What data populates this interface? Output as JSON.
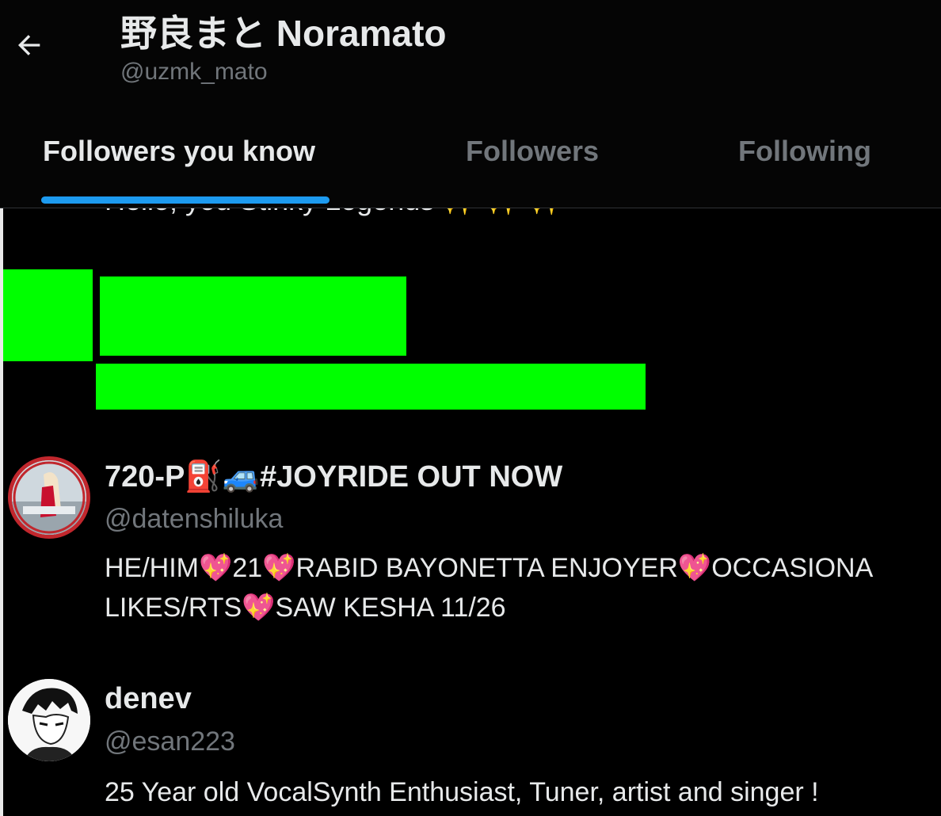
{
  "header": {
    "title": "野良まと Noramato",
    "handle": "@uzmk_mato",
    "back_label": "←"
  },
  "tabs": [
    {
      "label": "Followers you know",
      "active": true
    },
    {
      "label": "Followers",
      "active": false
    },
    {
      "label": "Following",
      "active": false
    }
  ],
  "cutoff_text": "Hello, you Stinky Legends ✨ ✨ ✨",
  "users": [
    {
      "name": "720-P⛽🚙#JOYRIDE OUT NOW",
      "handle": "@datenshiluka",
      "bio_line1": "HE/HIM💖21💖RABID BAYONETTA ENJOYER💖OCCASIONA",
      "bio_line2": "LIKES/RTS💖SAW KESHA 11/26"
    },
    {
      "name": "denev",
      "handle": "@esan223",
      "bio_line1": "25 Year old VocalSynth Enthusiast, Tuner, artist and singer !"
    }
  ],
  "colors": {
    "background": "#000000",
    "accent": "#1d9bf0",
    "muted_text": "#71767b",
    "primary_text": "#e7e9ea",
    "redaction": "#00ff00"
  }
}
